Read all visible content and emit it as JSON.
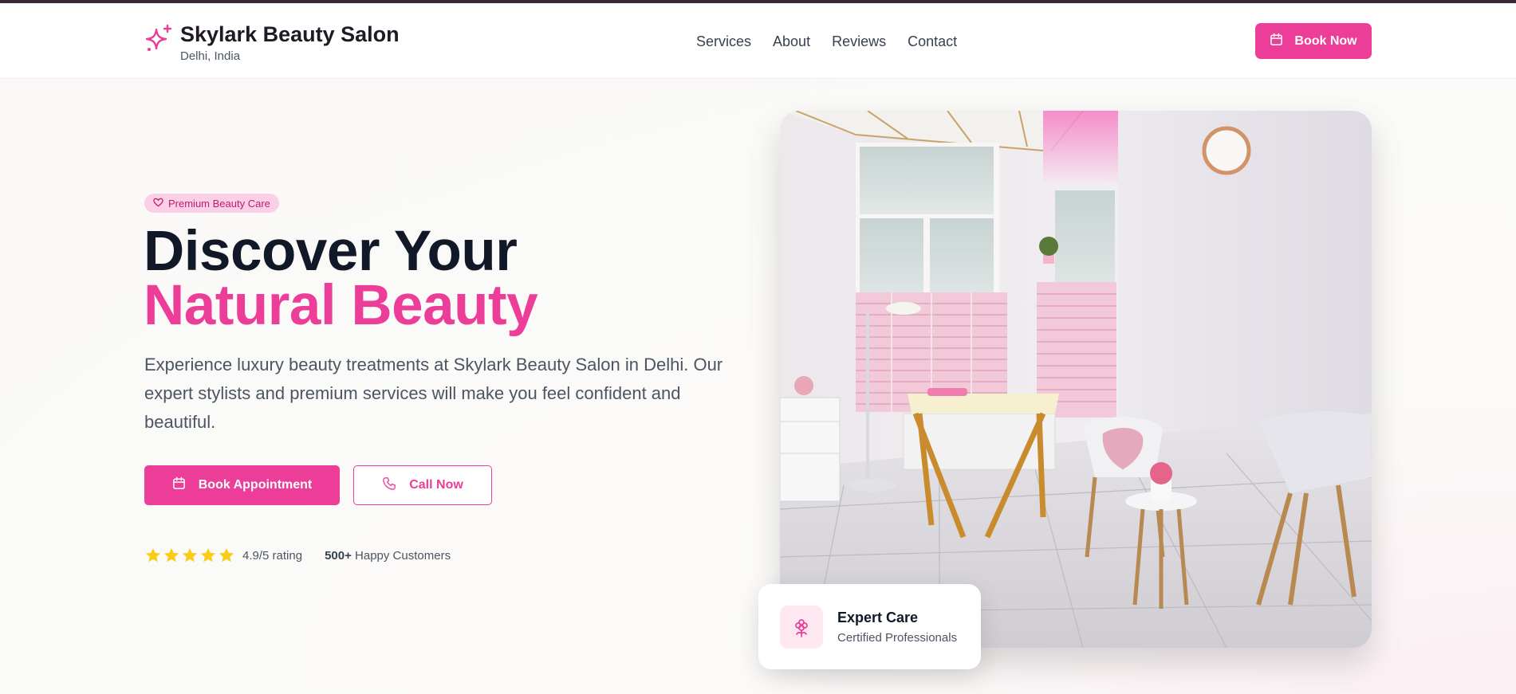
{
  "brand": {
    "name": "Skylark Beauty Salon",
    "location": "Delhi, India",
    "icon": "sparkles-icon"
  },
  "nav": {
    "items": [
      "Services",
      "About",
      "Reviews",
      "Contact"
    ]
  },
  "header": {
    "book_label": "Book Now"
  },
  "hero": {
    "badge": "Premium Beauty Care",
    "title_line1": "Discover Your",
    "title_line2": "Natural Beauty",
    "lead": "Experience luxury beauty treatments at Skylark Beauty Salon in Delhi. Our expert stylists and premium services will make you feel confident and beautiful.",
    "primary_button": "Book Appointment",
    "secondary_button": "Call Now",
    "rating": {
      "stars": 5,
      "text": "4.9/5 rating"
    },
    "customers_count": "500+",
    "customers_label": "Happy Customers"
  },
  "card": {
    "title": "Expert Care",
    "subtitle": "Certified Professionals",
    "icon": "flower-icon"
  },
  "colors": {
    "accent": "#ec3d99",
    "dark": "#111827",
    "star": "#facc15",
    "badge_bg": "#fbd0e6"
  }
}
